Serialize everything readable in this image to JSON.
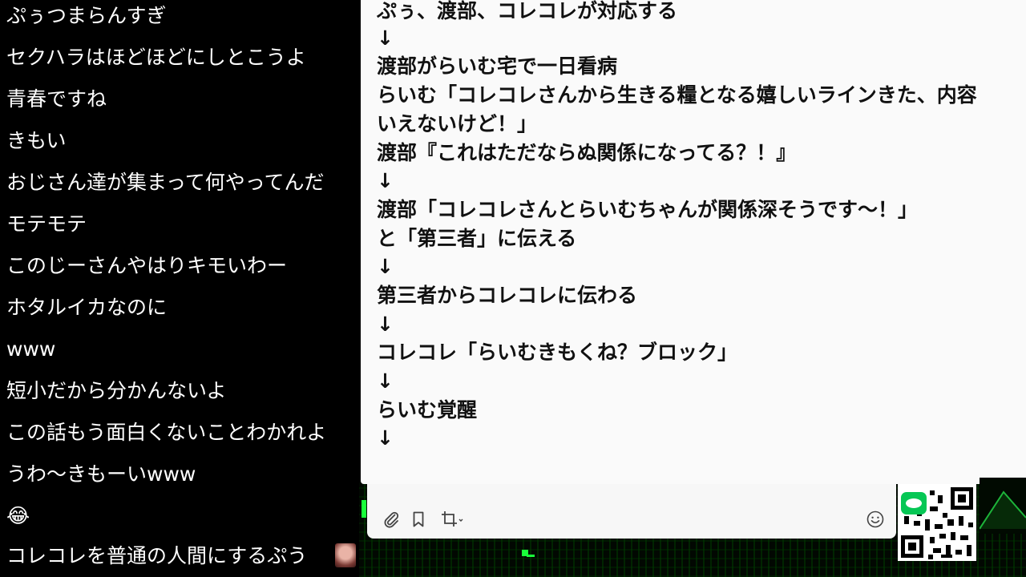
{
  "comments": [
    {
      "text": "ぷぅつまらんすぎ"
    },
    {
      "text": "セクハラはほどほどにしとこうよ"
    },
    {
      "text": "青春ですね"
    },
    {
      "text": "きもい"
    },
    {
      "text": "おじさん達が集まって何やってんだ"
    },
    {
      "text": "モテモテ"
    },
    {
      "text": "このじーさんやはりキモいわー"
    },
    {
      "text": "ホタルイカなのに"
    },
    {
      "text": "www"
    },
    {
      "text": "短小だから分かんないよ"
    },
    {
      "text": "この話もう面白くないことわかれよ"
    },
    {
      "text": "うわ～きもーいwww"
    },
    {
      "text": "😂"
    },
    {
      "text": "コレコレを普通の人間にするぷう"
    }
  ],
  "chat": {
    "lines": [
      "ぷぅ、渡部、コレコレが対応する",
      "↓",
      "渡部がらいむ宅で一日看病",
      "らいむ「コレコレさんから生きる糧となる嬉しいラインきた、内容",
      "いえないけど！」",
      "渡部『これはただならぬ関係になってる？！』",
      "↓",
      "渡部「コレコレさんとらいむちゃんが関係深そうです～！」",
      "と「第三者」に伝える",
      "↓",
      "第三者からコレコレに伝わる",
      "↓",
      "コレコレ「らいむきもくね？ブロック」",
      "↓",
      "らいむ覚醒",
      "↓"
    ]
  },
  "toolbar": {
    "buttons": [
      {
        "name": "attach-file-button",
        "icon": "paperclip-icon"
      },
      {
        "name": "bookmark-button",
        "icon": "bookmark-icon"
      },
      {
        "name": "screenshot-button",
        "icon": "crop-icon"
      },
      {
        "name": "emoji-button",
        "icon": "smiley-icon"
      }
    ]
  },
  "colors": {
    "feed_background": "#000000",
    "comment_text": "#ffffff",
    "chat_background": "#fafafa",
    "chat_text": "#111111",
    "accent_green": "#19ff3a",
    "line_green": "#06c755"
  }
}
